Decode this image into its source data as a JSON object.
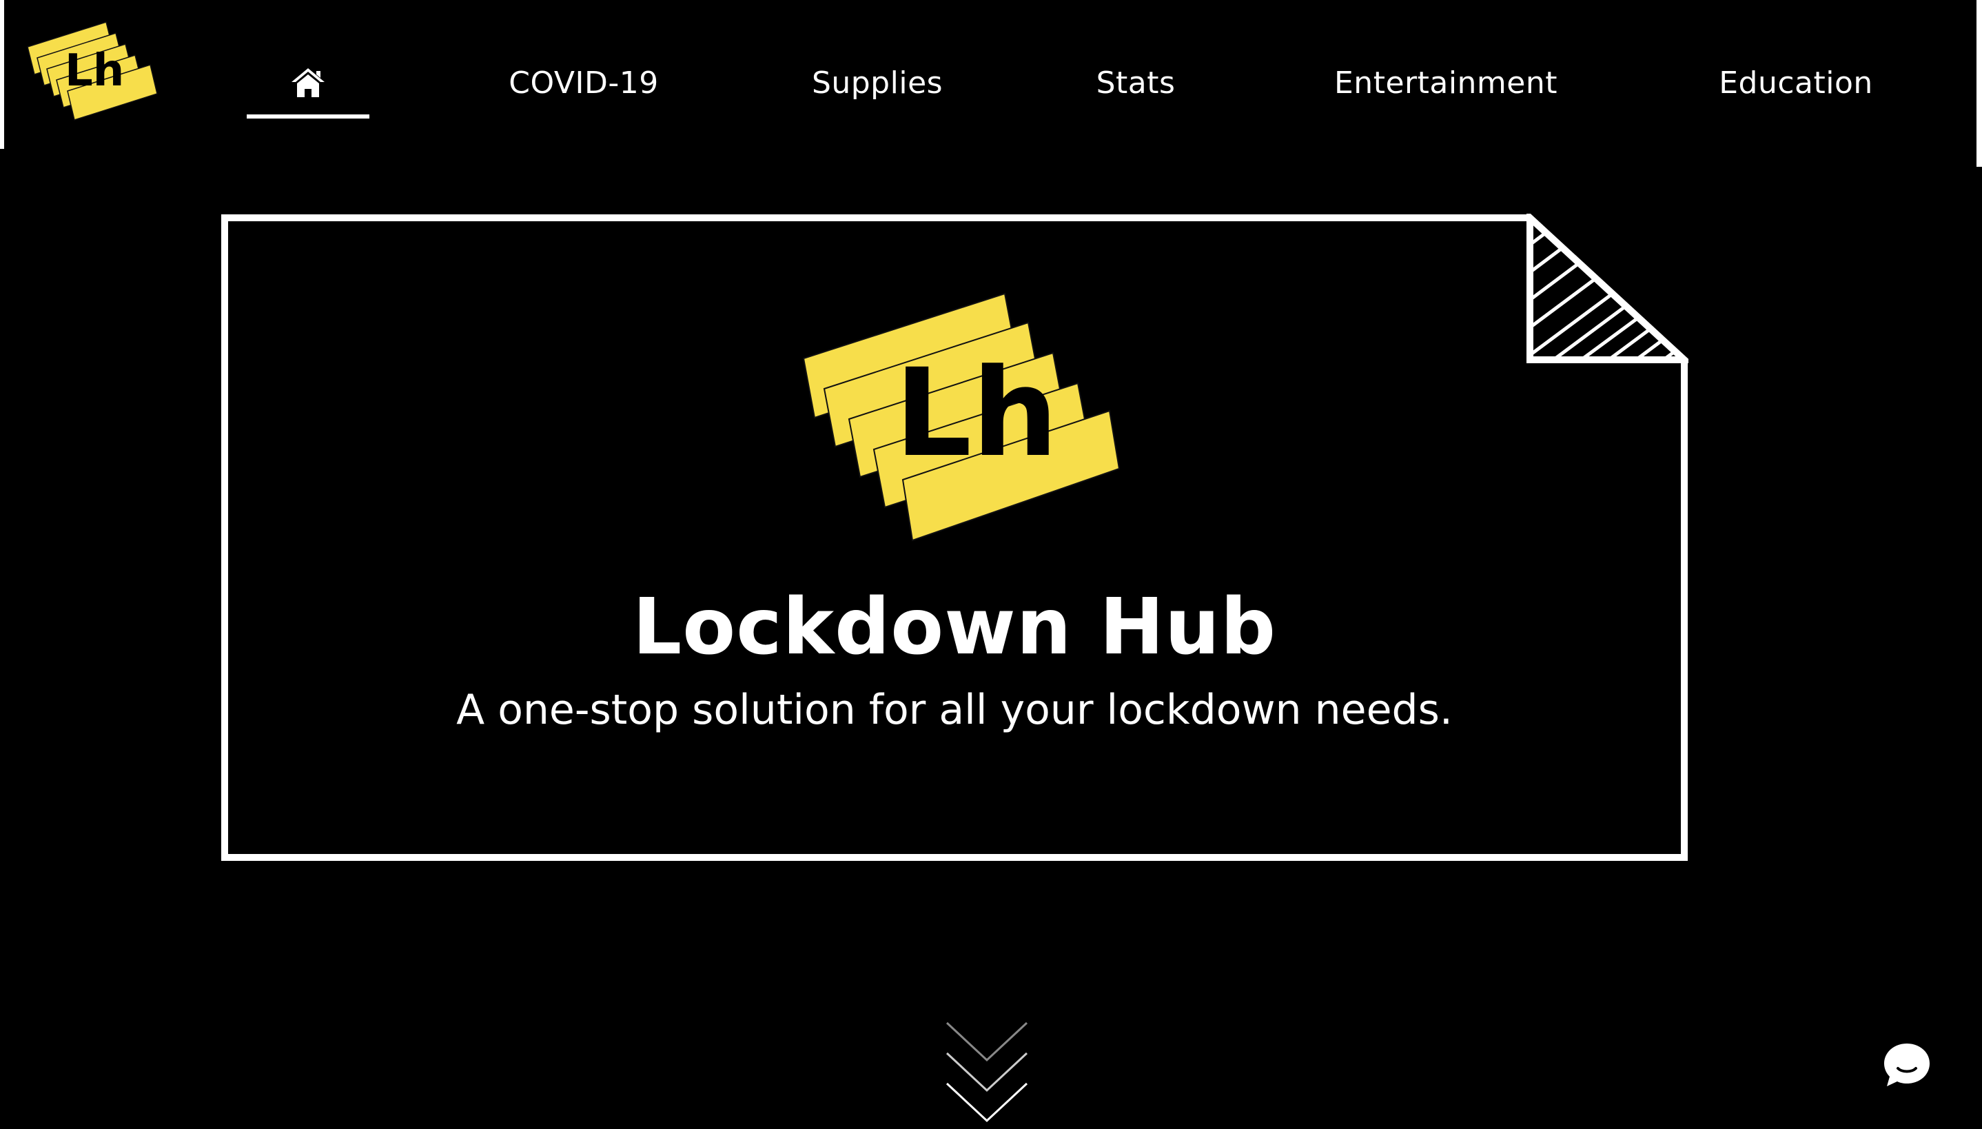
{
  "nav": {
    "logo_text": "Lh",
    "home_icon": "home-icon",
    "items": [
      {
        "label": "COVID-19"
      },
      {
        "label": "Supplies"
      },
      {
        "label": "Stats"
      },
      {
        "label": "Entertainment"
      },
      {
        "label": "Education"
      }
    ],
    "active_item": "home"
  },
  "hero": {
    "logo_text": "Lh",
    "title": "Lockdown Hub",
    "subtitle": "A one-stop solution for all your lockdown needs."
  },
  "scroll_down_icon": "chevrons-down-icon",
  "chat_icon": "chat-bubble-icon",
  "colors": {
    "background": "#000000",
    "brand_yellow": "#F7DE4B",
    "text": "#FFFFFF"
  }
}
